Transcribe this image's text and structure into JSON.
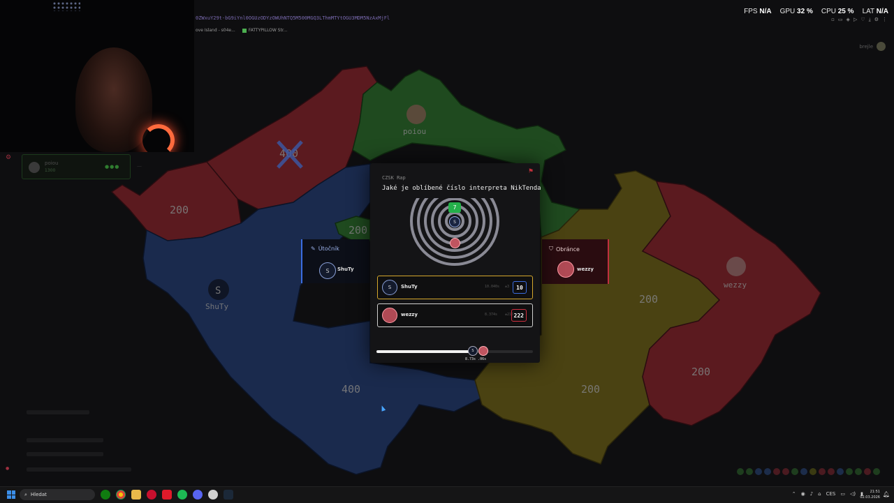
{
  "browser": {
    "url_fragment": "0ZWxuY29t-bG9iYnl0OGUzODYzOWUhNTQ5M500MGQ3LThmMTYtOGU3MDM5NzAxMjFl",
    "bookmarks": [
      "ove Island - s04e...",
      "FATTYPILLOW Str..."
    ]
  },
  "perf_overlay": {
    "fps_label": "FPS",
    "fps_value": "N/A",
    "gpu_label": "GPU",
    "gpu_value": "32",
    "cpu_label": "CPU",
    "cpu_value": "25",
    "lat_label": "LAT",
    "lat_value": "N/A",
    "percent_unit": "%"
  },
  "top_user": {
    "name": "brejle"
  },
  "left_panel": {
    "player_name": "poiou",
    "player_score": "1300",
    "hearts": "●●●",
    "dash": "—"
  },
  "map": {
    "region_labels": {
      "northwest": "400",
      "west": "200",
      "north_center": "poiou",
      "center_small": "200",
      "southwest_avatar": "S",
      "southwest_name": "ShuTy",
      "south": "400",
      "east_avatar_name": "wezzy",
      "east_mid": "200",
      "southeast_center": "200",
      "far_east": "200"
    },
    "colors": {
      "red": "#5b1a1f",
      "blue": "#1a2a4d",
      "green": "#1f4a1f",
      "yellow": "#4a4212"
    }
  },
  "attacker": {
    "role": "Útočník",
    "avatar_letter": "S",
    "name": "ShuTy"
  },
  "defender": {
    "role": "Obránce",
    "name": "wezzy"
  },
  "question": {
    "category": "CZSK Rap",
    "text": "Jaké je oblíbené číslo interpreta NikTenda",
    "correct_answer": "7",
    "guess_letter": "S"
  },
  "results": [
    {
      "avatar": "S",
      "name": "ShuTy",
      "time": "10.040s",
      "diff": "±3",
      "answer": "10"
    },
    {
      "avatar": "",
      "name": "wezzy",
      "time": "8.374s",
      "diff": "±215",
      "answer": "222"
    }
  ],
  "timeline": {
    "progress": 0.6,
    "marker_letter": "S",
    "time_a": "8.73s",
    "time_b": ".06s"
  },
  "taskbar": {
    "search_placeholder": "Hledat",
    "language": "CES",
    "clock_time": "21:51",
    "clock_date": "02.03.2026"
  }
}
